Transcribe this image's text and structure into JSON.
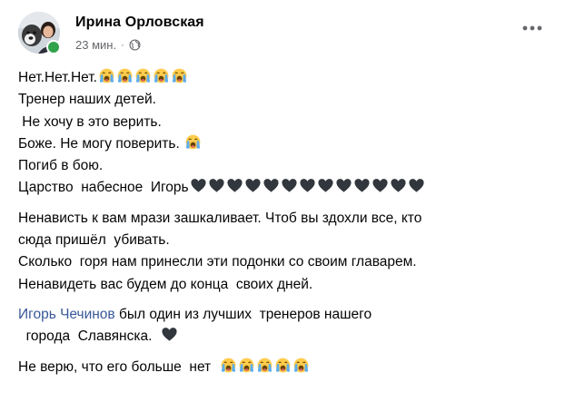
{
  "post": {
    "author": "Ирина Орловская",
    "time": "23 мин.",
    "separator": "·",
    "paragraph1": [
      {
        "text": "Нет.Нет.Нет.",
        "emoji": "crying-face",
        "emoji_count": 5
      },
      {
        "text": "Тренер наших детей.",
        "emoji": null,
        "emoji_count": 0
      },
      {
        "text": " Не хочу в это верить.",
        "emoji": null,
        "emoji_count": 0
      },
      {
        "text": "Боже. Не могу поверить. ",
        "emoji": "crying-face",
        "emoji_count": 1
      },
      {
        "text": "Погиб в бою.",
        "emoji": null,
        "emoji_count": 0
      },
      {
        "text": "Царство  набесное  Игорь",
        "emoji": "black-heart",
        "emoji_count": 13
      }
    ],
    "paragraph2": [
      "Ненависть к вам мрази зашкаливает. Чтоб вы здохли все, кто",
      "сюда пришёл  убивать.",
      "Сколько  горя нам принесли эти подонки со своим главарем.",
      "Ненавидеть вас будем до конца  своих дней."
    ],
    "paragraph3": {
      "mention": "Игорь Чечинов",
      "line1_rest": " был один из лучших  тренеров нашего",
      "line2": "  города  Славянска.  ",
      "line2_emoji": "black-heart"
    },
    "paragraph4": {
      "text": "Не верю, что его больше  нет  ",
      "emoji": "crying-face",
      "emoji_count": 5
    }
  },
  "icons": {
    "globe": "globe-icon",
    "more": "more-options-icon",
    "status": "online-status-icon"
  },
  "colors": {
    "text": "#050505",
    "meta": "#65676b",
    "link": "#385898",
    "online": "#31a24c",
    "emoji_face": "#ffcc4d",
    "emoji_tear": "#5dadec",
    "heart": "#31373d"
  }
}
